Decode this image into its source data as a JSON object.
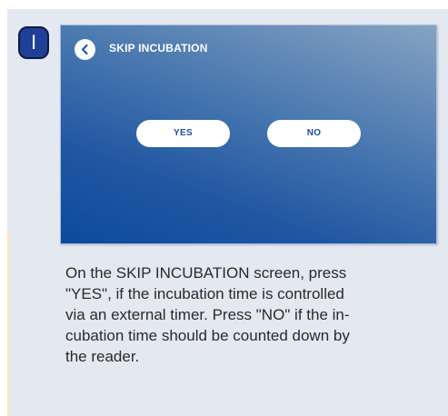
{
  "step": {
    "letter": "I"
  },
  "screen": {
    "title": "SKIP INCUBATION",
    "yes_label": "YES",
    "no_label": "NO",
    "back_icon": "chevron-left-icon"
  },
  "instructions": {
    "lines": [
      "On the SKIP INCUBATION screen, press",
      "\"YES\", if the incubation time is controlled",
      "via an external timer. Press \"NO\" if the in-",
      "cubation time should be counted down by",
      "the reader."
    ]
  },
  "colors": {
    "card_background": "#e4e8f1",
    "badge_fill": "#1f3f98",
    "screen_gradient_light": "#86a3c2",
    "screen_gradient_dark": "#0d4a9d",
    "button_text": "#1b4f9c"
  }
}
